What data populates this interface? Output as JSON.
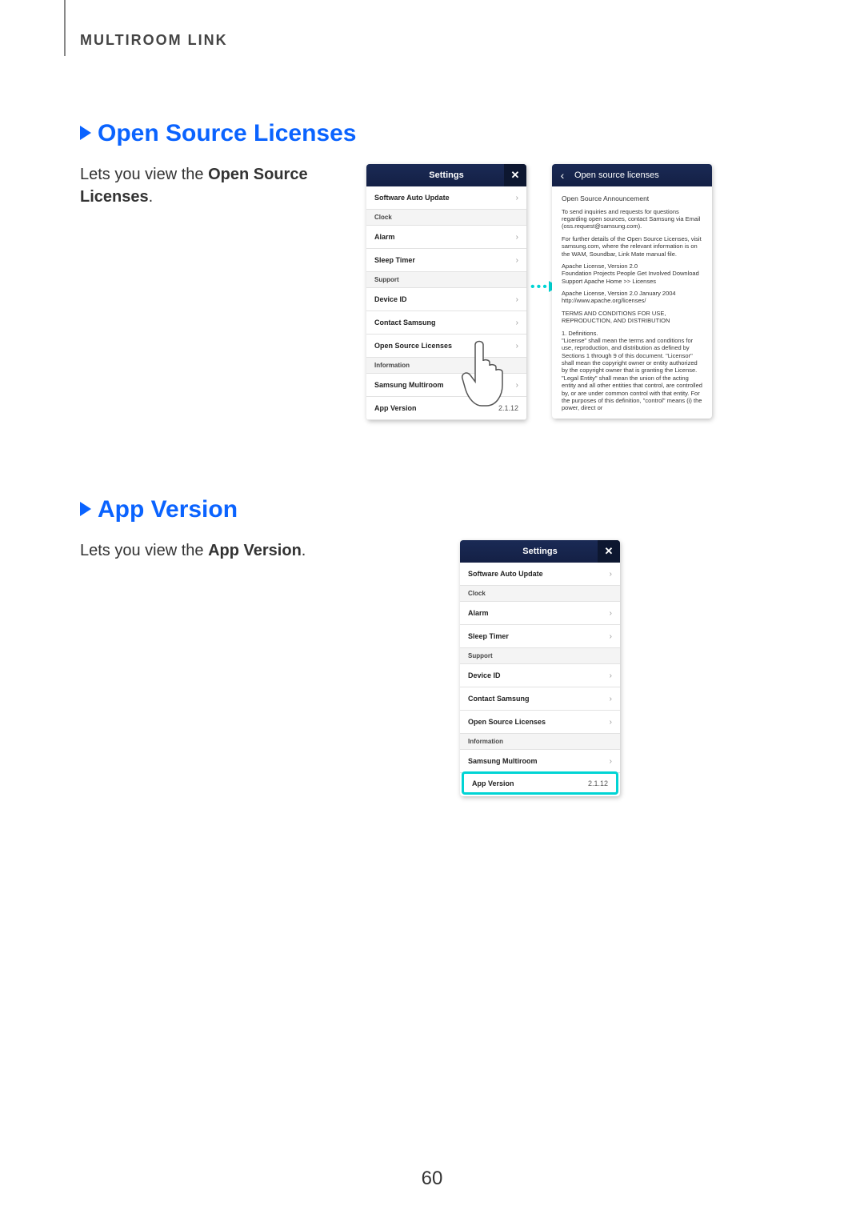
{
  "header": "MULTIROOM LINK",
  "page_number": "60",
  "sections": [
    {
      "title": "Open Source Licenses",
      "desc_pre": "Lets you view the ",
      "desc_bold": "Open Source Licenses",
      "desc_post": "."
    },
    {
      "title": "App Version",
      "desc_pre": "Lets you view the ",
      "desc_bold": "App Version",
      "desc_post": "."
    }
  ],
  "settings_panel": {
    "title": "Settings",
    "rows": [
      {
        "label": "Software Auto Update",
        "chev": true
      },
      {
        "group": "Clock"
      },
      {
        "label": "Alarm",
        "chev": true
      },
      {
        "label": "Sleep Timer",
        "chev": true
      },
      {
        "group": "Support"
      },
      {
        "label": "Device ID",
        "chev": true
      },
      {
        "label": "Contact Samsung",
        "chev": true
      },
      {
        "label": "Open Source Licenses",
        "chev": true
      },
      {
        "group": "Information"
      },
      {
        "label": "Samsung Multiroom",
        "chev": true
      },
      {
        "label": "App Version",
        "value": "2.1.12"
      }
    ]
  },
  "license_panel": {
    "title": "Open source licenses",
    "announcement": "Open Source Announcement",
    "p1": "To send inquiries and requests for questions regarding open sources, contact Samsung via Email (oss.request@samsung.com).",
    "p2": "For further details of the Open Source Licenses, visit samsung.com, where the relevant information is on the WAM, Soundbar, Link Mate manual file.",
    "p3": "Apache License, Version 2.0\nFoundation Projects People Get Involved Download Support Apache Home >> Licenses",
    "p4": "Apache License, Version 2.0 January 2004\nhttp://www.apache.org/licenses/",
    "p5": "TERMS AND CONDITIONS FOR USE, REPRODUCTION, AND DISTRIBUTION",
    "p6": "1. Definitions.\n\"License\" shall mean the terms and conditions for use, reproduction, and distribution as defined by Sections 1 through 9 of this document. \"Licensor\" shall mean the copyright owner or entity authorized by the copyright owner that is granting the License. \"Legal Entity\" shall mean the union of the acting entity and all other entities that control, are controlled by, or are under common control with that entity. For the purposes of this definition, \"control\" means (i) the power, direct or"
  }
}
